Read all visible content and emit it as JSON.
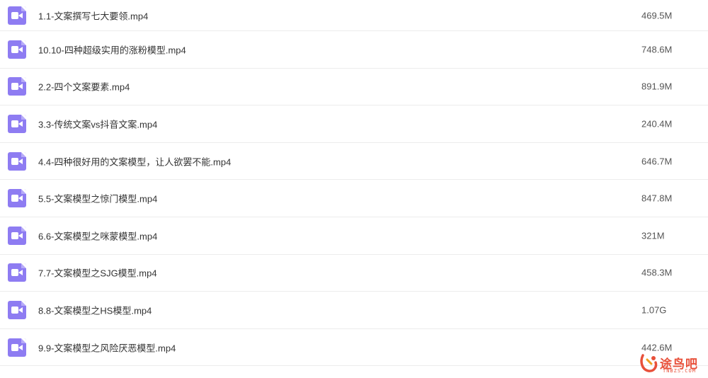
{
  "files": [
    {
      "name": "1.1-文案撰写七大要领.mp4",
      "size": "469.5M",
      "icon": "video-file-icon"
    },
    {
      "name": "10.10-四种超级实用的涨粉模型.mp4",
      "size": "748.6M",
      "icon": "video-file-icon"
    },
    {
      "name": "2.2-四个文案要素.mp4",
      "size": "891.9M",
      "icon": "video-file-icon"
    },
    {
      "name": "3.3-传统文案vs抖音文案.mp4",
      "size": "240.4M",
      "icon": "video-file-icon"
    },
    {
      "name": "4.4-四种很好用的文案模型，让人欲罢不能.mp4",
      "size": "646.7M",
      "icon": "video-file-icon"
    },
    {
      "name": "5.5-文案模型之惊门模型.mp4",
      "size": "847.8M",
      "icon": "video-file-icon"
    },
    {
      "name": "6.6-文案模型之咪蒙模型.mp4",
      "size": "321M",
      "icon": "video-file-icon"
    },
    {
      "name": "7.7-文案模型之SJG模型.mp4",
      "size": "458.3M",
      "icon": "video-file-icon"
    },
    {
      "name": "8.8-文案模型之HS模型.mp4",
      "size": "1.07G",
      "icon": "video-file-icon"
    },
    {
      "name": "9.9-文案模型之风险厌恶模型.mp4",
      "size": "442.6M",
      "icon": "video-file-icon"
    }
  ],
  "watermark": {
    "text": "途鸟吧",
    "sub": "TNBZS.COM"
  },
  "colors": {
    "icon_bg": "#8e7cf2",
    "divider": "#ececec",
    "watermark": "#e8503a"
  }
}
